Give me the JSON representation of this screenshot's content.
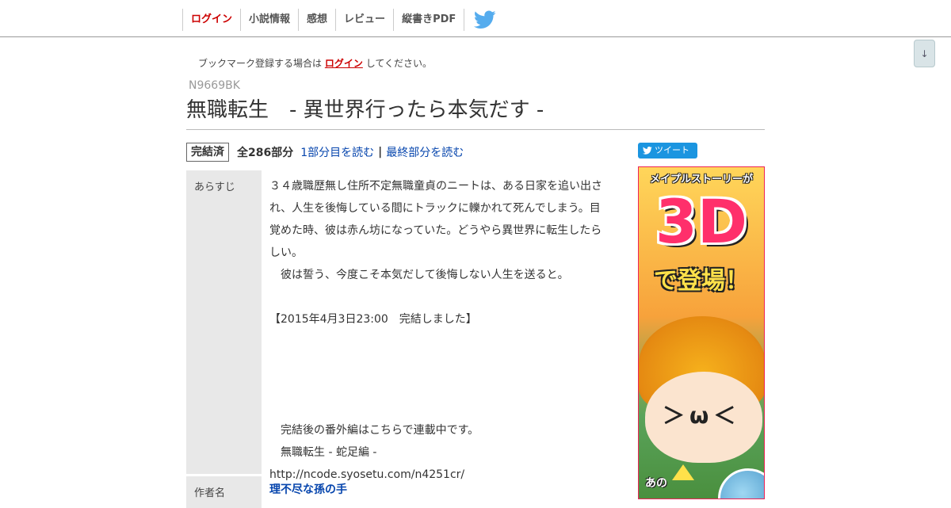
{
  "nav": {
    "items": [
      {
        "label": "ログイン"
      },
      {
        "label": "小説情報"
      },
      {
        "label": "感想"
      },
      {
        "label": "レビュー"
      },
      {
        "label": "縦書きPDF"
      }
    ],
    "twitter_icon": "twitter-bird-icon"
  },
  "scroll_button": {
    "label": "↓"
  },
  "bookmark": {
    "prefix": "ブックマーク登録する場合は",
    "login_link": "ログイン",
    "suffix": "してください。"
  },
  "novel": {
    "ncode": "N9669BK",
    "title": "無職転生　- 異世界行ったら本気だす -",
    "status": "完結済",
    "parts_count": "全286部分",
    "first_link": "1部分目を読む",
    "separator": "|",
    "last_link": "最終部分を読む"
  },
  "tweet_button": {
    "label": "ツイート"
  },
  "synopsis": {
    "label": "あらすじ",
    "lines": [
      "３４歳職歴無し住所不定無職童貞のニートは、ある日家を追い出さ",
      "れ、人生を後悔している間にトラックに轢かれて死んでしまう。目",
      "覚めた時、彼は赤ん坊になっていた。どうやら異世界に転生したら",
      "しい。",
      "　彼は誓う、今度こそ本気だして後悔しない人生を送ると。",
      "",
      "【2015年4月3日23:00　完結しました】",
      "",
      "",
      "",
      "",
      "　完結後の番外編はこちらで連載中です。",
      "　無職転生 - 蛇足編 -",
      "http://ncode.syosetu.com/n4251cr/"
    ]
  },
  "author": {
    "label": "作者名",
    "name": "理不尽な孫の手"
  },
  "ad": {
    "top_text": "メイプルストーリーが",
    "big_text": "3D",
    "sub_text": "で登場！",
    "face": "＞ω＜",
    "bottom_text": "あの"
  }
}
